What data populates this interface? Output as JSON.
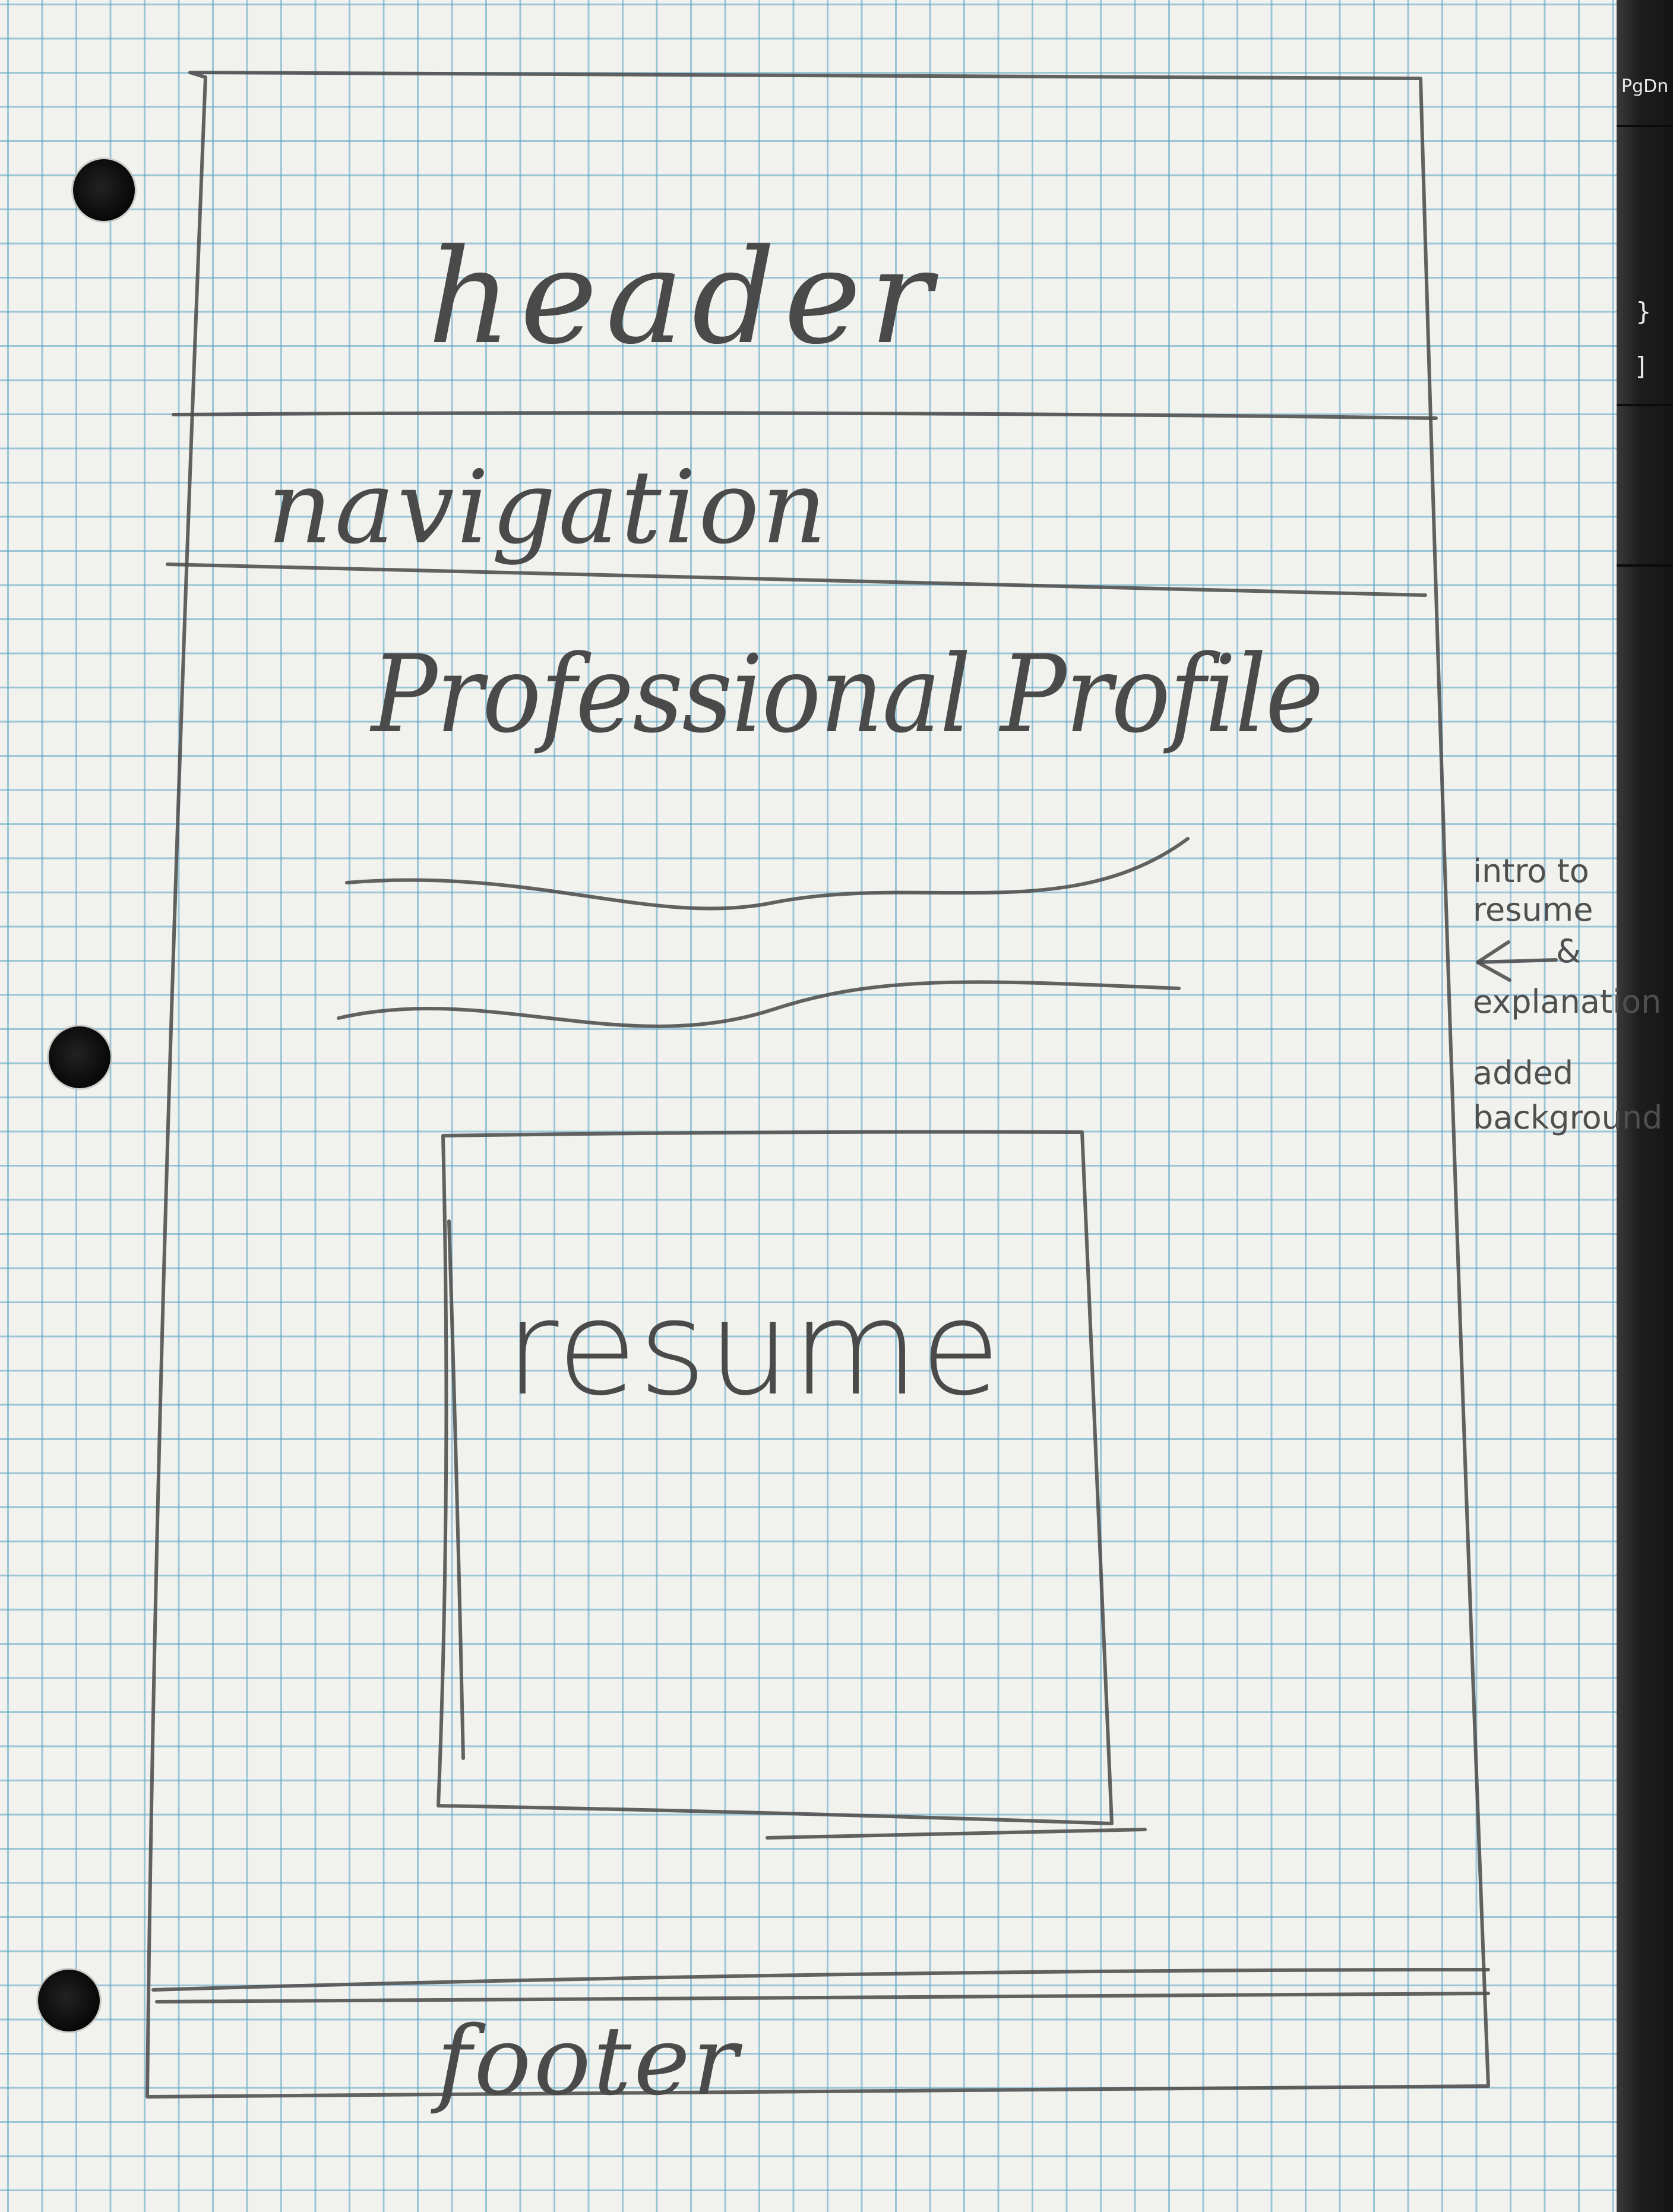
{
  "wireframe": {
    "header_label": "header",
    "navigation_label": "navigation",
    "profile_title": "Professional Profile",
    "resume_label": "resume",
    "footer_label": "footer"
  },
  "side_note": {
    "lines": [
      "intro to",
      "resume",
      "&",
      "explanation",
      "added",
      "background"
    ]
  },
  "keyboard": {
    "key_labels": [
      "PgDn",
      "}",
      "]"
    ]
  },
  "colors": {
    "paper": "#f1f1ed",
    "grid": "#56a0c4",
    "pencil": "#4c4c4c",
    "keyboard": "#1d1d1d"
  }
}
